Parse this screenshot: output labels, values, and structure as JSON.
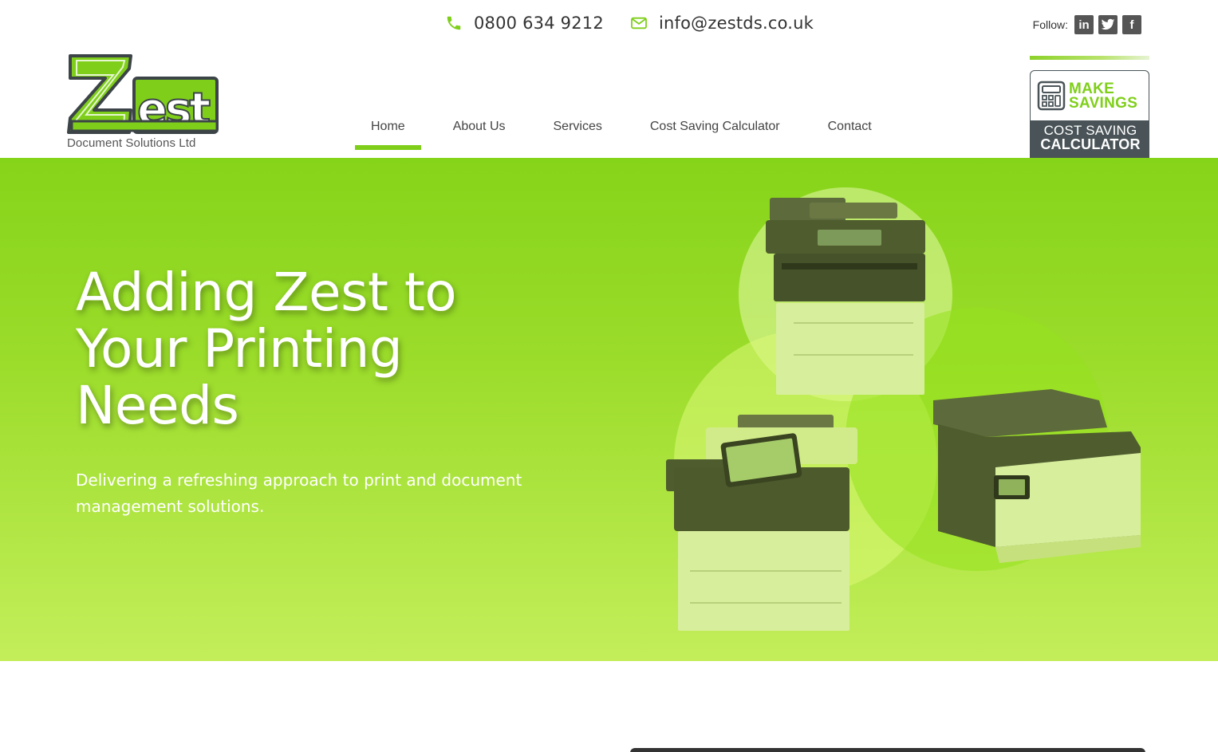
{
  "topbar": {
    "phone": "0800 634 9212",
    "email": "info@zestds.co.uk",
    "follow_label": "Follow:",
    "social": [
      {
        "icon": "linkedin-icon",
        "glyph": "in"
      },
      {
        "icon": "twitter-icon",
        "glyph": "t"
      },
      {
        "icon": "facebook-icon",
        "glyph": "f"
      }
    ]
  },
  "logo": {
    "wordmark": "Zest",
    "tagline": "Document Solutions Ltd"
  },
  "nav": {
    "items": [
      {
        "label": "Home",
        "active": true
      },
      {
        "label": "About Us",
        "active": false
      },
      {
        "label": "Services",
        "active": false
      },
      {
        "label": "Cost Saving Calculator",
        "active": false
      },
      {
        "label": "Contact",
        "active": false
      }
    ]
  },
  "calculator_badge": {
    "line1": "MAKE",
    "line2": "SAVINGS",
    "line3": "COST SAVING",
    "line4": "CALCULATOR"
  },
  "hero": {
    "title_line1": "Adding Zest to",
    "title_line2": "Your Printing",
    "title_line3": "Needs",
    "subtitle": "Delivering a refreshing approach to print and document management solutions."
  },
  "colors": {
    "brand_green": "#7fcf1a",
    "hero_top": "#86d41a",
    "hero_bottom": "#c3ee5a",
    "dark_slate": "#4a5458"
  }
}
